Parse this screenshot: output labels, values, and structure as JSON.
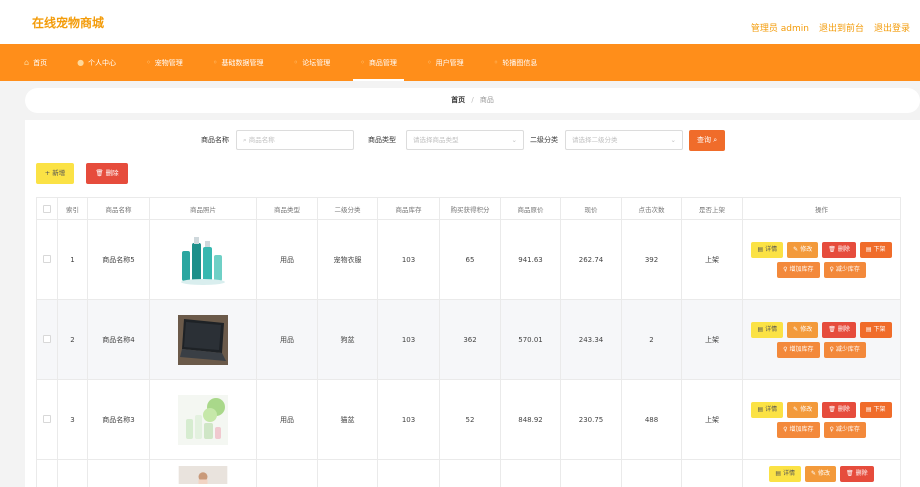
{
  "header": {
    "brand": "在线宠物商城",
    "admin_label": "管理员 admin",
    "exit_front": "退出到前台",
    "logout": "退出登录"
  },
  "nav": [
    {
      "label": "首页",
      "icon": "home-icon",
      "glyph": "⌂"
    },
    {
      "label": "个人中心",
      "icon": "user-icon",
      "glyph": "👤"
    },
    {
      "label": "宠物管理",
      "icon": "menu-icon",
      "glyph": "◦"
    },
    {
      "label": "基础数据管理",
      "icon": "menu-icon",
      "glyph": "◦"
    },
    {
      "label": "论坛管理",
      "icon": "menu-icon",
      "glyph": "◦"
    },
    {
      "label": "商品管理",
      "icon": "menu-icon",
      "glyph": "◦"
    },
    {
      "label": "用户管理",
      "icon": "menu-icon",
      "glyph": "◦"
    },
    {
      "label": "轮播图信息",
      "icon": "menu-icon",
      "glyph": "◦"
    }
  ],
  "breadcrumb": {
    "home": "首页",
    "sep": "/",
    "current": "商品"
  },
  "search": {
    "name_label": "商品名称",
    "name_placeholder": "商品名称",
    "type_label": "商品类型",
    "type_placeholder": "请选择商品类型",
    "subtype_label": "二级分类",
    "subtype_placeholder": "请选择二级分类",
    "query_button": "查询"
  },
  "toolbar": {
    "add": "+ 新增",
    "delete": "删除"
  },
  "table": {
    "columns": [
      "索引",
      "商品名称",
      "商品照片",
      "商品类型",
      "二级分类",
      "商品库存",
      "购买获得积分",
      "商品原价",
      "现价",
      "点击次数",
      "是否上架",
      "操作"
    ],
    "rows": [
      {
        "index": "1",
        "name": "商品名称5",
        "type": "用品",
        "subtype": "宠物衣服",
        "stock": "103",
        "points": "65",
        "orig": "941.63",
        "price": "262.74",
        "clicks": "392",
        "shelf": "上架"
      },
      {
        "index": "2",
        "name": "商品名称4",
        "type": "用品",
        "subtype": "狗盆",
        "stock": "103",
        "points": "362",
        "orig": "570.01",
        "price": "243.34",
        "clicks": "2",
        "shelf": "上架"
      },
      {
        "index": "3",
        "name": "商品名称3",
        "type": "用品",
        "subtype": "猫盆",
        "stock": "103",
        "points": "52",
        "orig": "848.92",
        "price": "230.75",
        "clicks": "488",
        "shelf": "上架"
      }
    ],
    "actions": {
      "detail": "详情",
      "edit": "修改",
      "delete": "删除",
      "down": "下架",
      "addstock": "增加库存",
      "reduce": "减少库存"
    }
  },
  "colors": {
    "accent": "#ff8e1a",
    "brand": "#f39c0b",
    "danger": "#e64c3c",
    "warning": "#fbe245"
  }
}
